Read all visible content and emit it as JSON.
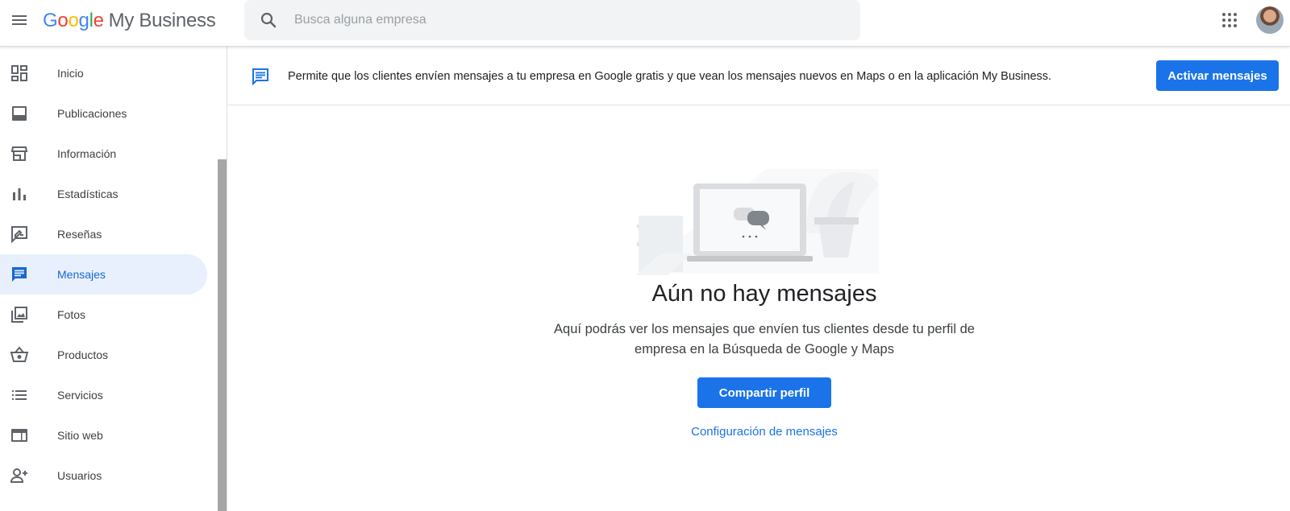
{
  "header": {
    "logo_letters": [
      "G",
      "o",
      "o",
      "g",
      "l",
      "e"
    ],
    "logo_product": "My Business",
    "search_placeholder": "Busca alguna empresa"
  },
  "sidebar": {
    "items": [
      {
        "label": "Inicio",
        "icon": "dashboard-icon"
      },
      {
        "label": "Publicaciones",
        "icon": "post-icon"
      },
      {
        "label": "Información",
        "icon": "storefront-icon"
      },
      {
        "label": "Estadísticas",
        "icon": "bar-chart-icon"
      },
      {
        "label": "Reseñas",
        "icon": "rate-review-icon"
      },
      {
        "label": "Mensajes",
        "icon": "message-icon",
        "active": true
      },
      {
        "label": "Fotos",
        "icon": "photo-library-icon"
      },
      {
        "label": "Productos",
        "icon": "basket-icon"
      },
      {
        "label": "Servicios",
        "icon": "list-icon"
      },
      {
        "label": "Sitio web",
        "icon": "web-icon"
      },
      {
        "label": "Usuarios",
        "icon": "person-add-icon"
      }
    ]
  },
  "banner": {
    "text": "Permite que los clientes envíen mensajes a tu empresa en Google gratis y que vean los mensajes nuevos en Maps o en la aplicación My Business.",
    "button_label": "Activar mensajes"
  },
  "empty_state": {
    "title": "Aún no hay mensajes",
    "description": "Aquí podrás ver los mensajes que envíen tus clientes desde tu perfil de empresa en la Búsqueda de Google y Maps",
    "share_button": "Compartir perfil",
    "settings_link": "Configuración de mensajes"
  },
  "colors": {
    "accent": "#1a73e8",
    "active_bg": "#e8f0fe",
    "active_text": "#1967d2"
  }
}
